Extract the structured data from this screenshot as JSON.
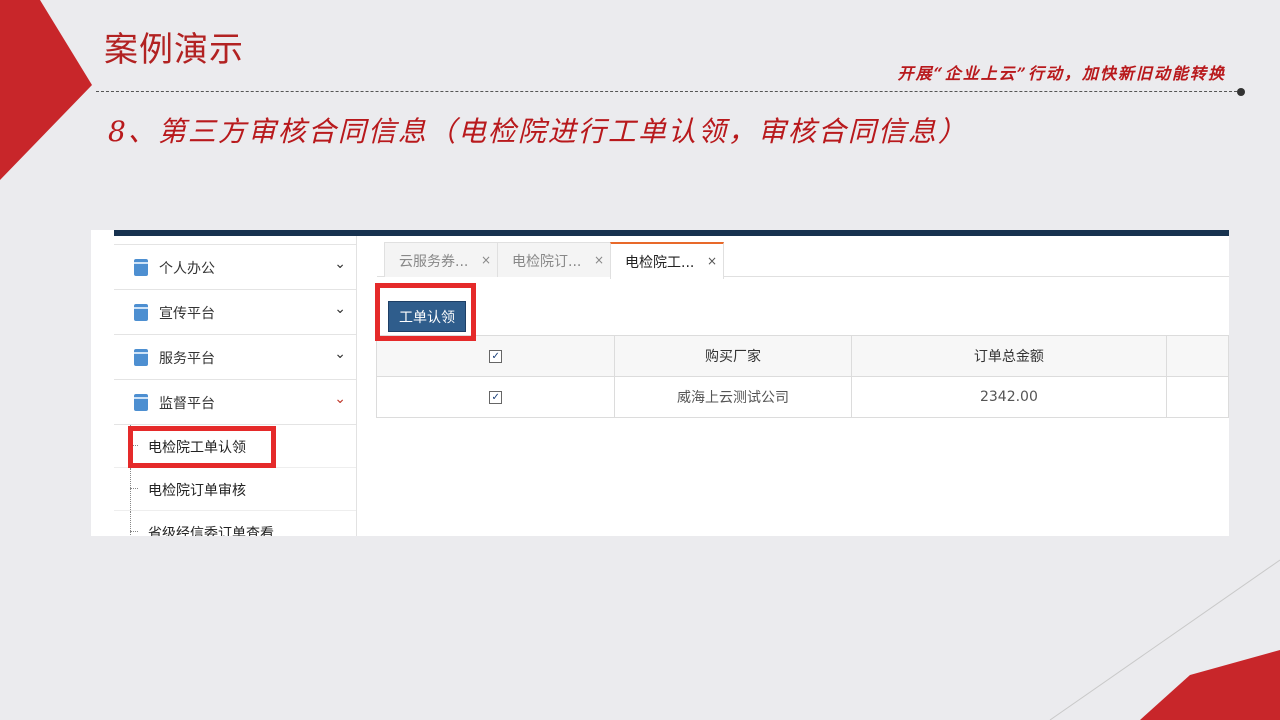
{
  "slide": {
    "title": "案例演示",
    "slogan": "开展“企业上云”行动，加快新旧动能转换",
    "subtitle": "8、第三方审核合同信息（电检院进行工单认领，审核合同信息）",
    "accent_color": "#c0262a"
  },
  "sidebar": {
    "menus": [
      {
        "label": "个人办公",
        "icon": "document-icon",
        "chevron": "⌄"
      },
      {
        "label": "宣传平台",
        "icon": "document-icon",
        "chevron": "⌄"
      },
      {
        "label": "服务平台",
        "icon": "document-icon",
        "chevron": "⌄"
      },
      {
        "label": "监督平台",
        "icon": "document-icon",
        "chevron": "⌄"
      }
    ],
    "submenu": [
      {
        "label": "电检院工单认领"
      },
      {
        "label": "电检院订单审核"
      },
      {
        "label": "省级经信委订单查看"
      }
    ]
  },
  "tabs": [
    {
      "label": "云服务券...",
      "close": "×"
    },
    {
      "label": "电检院订...",
      "close": "×"
    },
    {
      "label": "电检院工...",
      "close": "×",
      "active": true
    }
  ],
  "toolbar": {
    "claim_button": "工单认领"
  },
  "table": {
    "headers": [
      "",
      "购买厂家",
      "订单总金额",
      ""
    ],
    "rows": [
      {
        "checked": true,
        "buyer": "威海上云测试公司",
        "amount": "2342.00"
      }
    ]
  }
}
